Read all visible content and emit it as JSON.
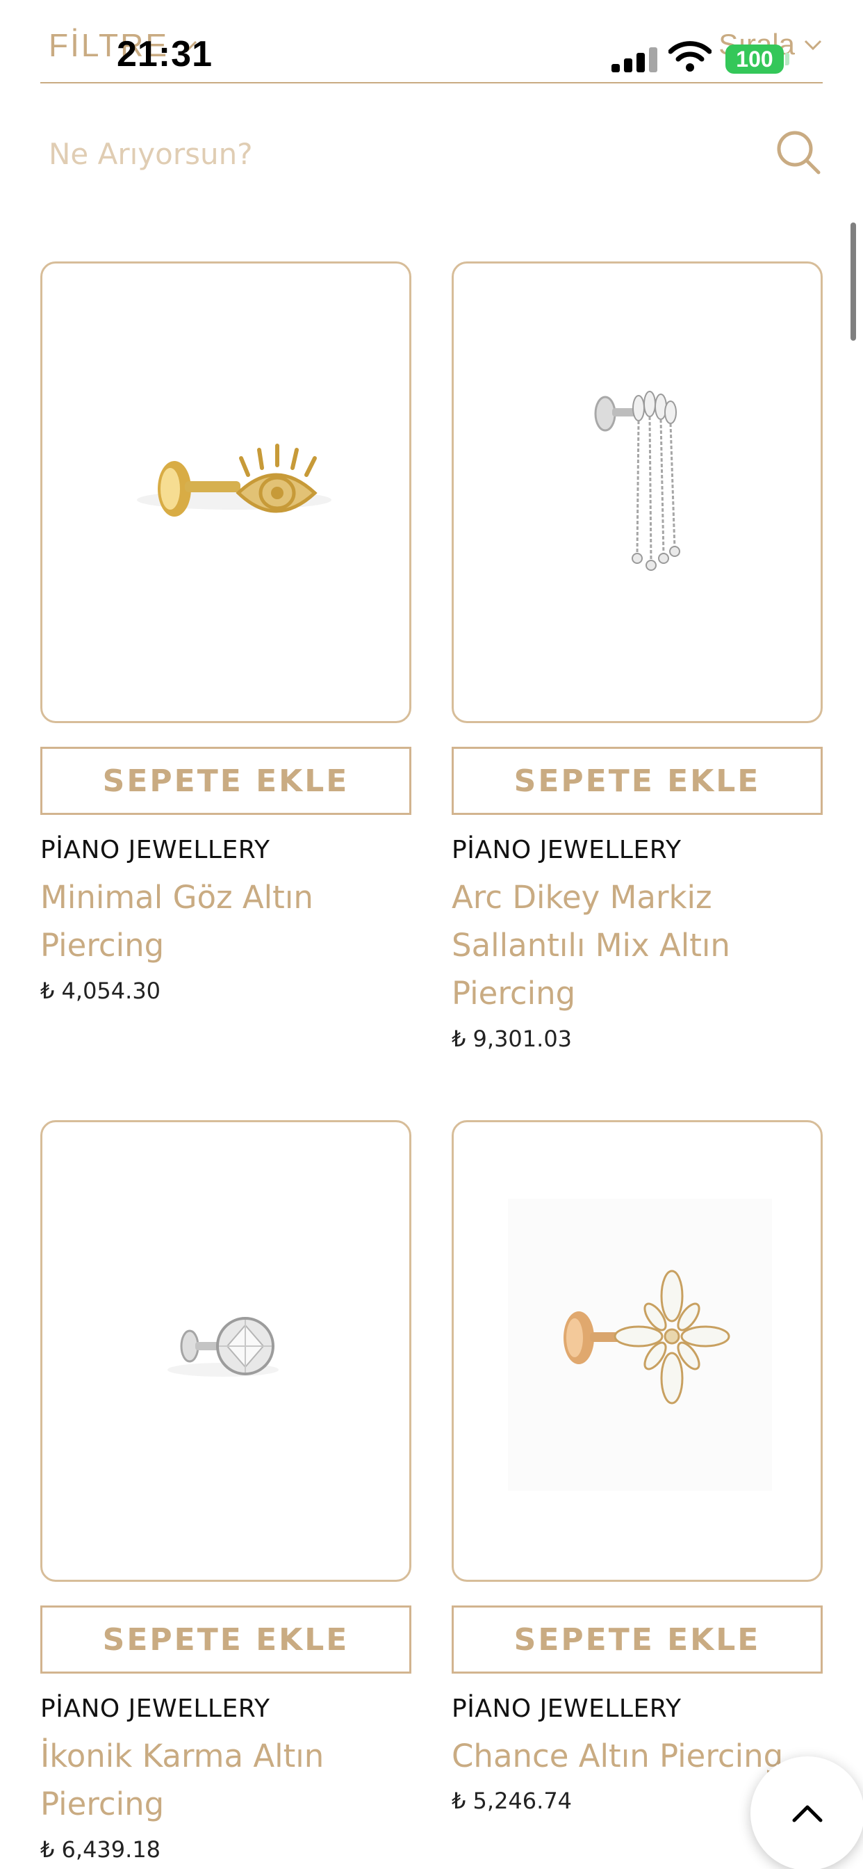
{
  "status_bar": {
    "time": "21:31",
    "battery": "100"
  },
  "toolbar": {
    "filter_label": "FİLTRE",
    "sort_label": "Sırala"
  },
  "search": {
    "placeholder": "Ne Arıyorsun?",
    "value": ""
  },
  "add_to_cart_label": "SEPETE EKLE",
  "products": [
    {
      "brand": "PİANO JEWELLERY",
      "name": "Minimal Göz Altın Piercing",
      "price": "₺ 4,054.30",
      "image": "gold-eye-piercing"
    },
    {
      "brand": "PİANO JEWELLERY",
      "name": "Arc Dikey Markiz Sallantılı Mix Altın Piercing",
      "price": "₺ 9,301.03",
      "image": "silver-chain-dangle-piercing"
    },
    {
      "brand": "PİANO JEWELLERY",
      "name": "İkonik Karma Altın Piercing",
      "price": "₺ 6,439.18",
      "image": "silver-stone-stud-piercing"
    },
    {
      "brand": "PİANO JEWELLERY",
      "name": "Chance Altın Piercing",
      "price": "₺ 5,246.74",
      "image": "gold-flower-marquise-piercing"
    }
  ],
  "colors": {
    "accent": "#c9ab82",
    "border": "#d7bd99",
    "battery": "#34c759",
    "text": "#111111"
  }
}
